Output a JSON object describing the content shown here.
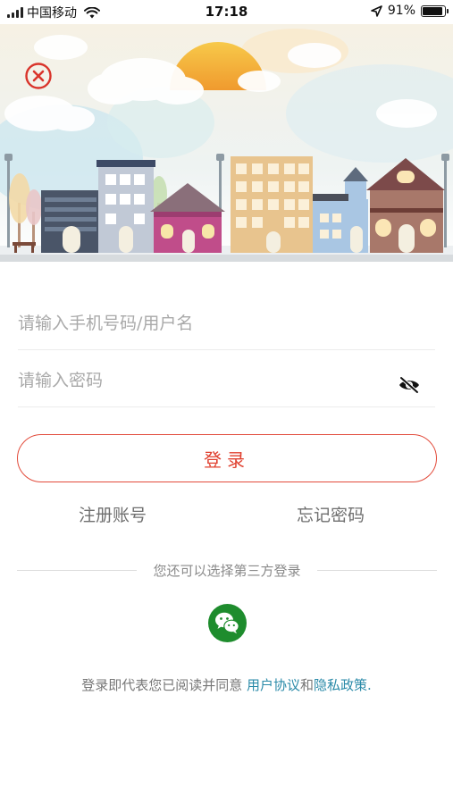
{
  "status_bar": {
    "carrier": "中国移动",
    "time": "17:18",
    "battery": "91%",
    "battery_level": 0.91,
    "icons": [
      "signal-icon",
      "wifi-icon",
      "location-arrow-icon",
      "battery-icon"
    ]
  },
  "banner": {
    "close_icon": "close-circle-icon",
    "illustration": "town-illustration"
  },
  "form": {
    "username_placeholder": "请输入手机号码/用户名",
    "password_placeholder": "请输入密码",
    "password_toggle_icon": "eye-off-icon",
    "login_label": "登录"
  },
  "links": {
    "register": "注册账号",
    "forgot": "忘记密码"
  },
  "third_party": {
    "divider_text": "您还可以选择第三方登录",
    "wechat_icon": "wechat-icon"
  },
  "agreement": {
    "prefix": "登录即代表您已阅读并同意 ",
    "user_agreement": "用户协议",
    "and": "和",
    "privacy_policy": "隐私政策",
    "suffix": "."
  },
  "colors": {
    "accent_red": "#e24b3b",
    "link_teal": "#2a8aa8",
    "wechat_green": "#1e8c2d"
  }
}
